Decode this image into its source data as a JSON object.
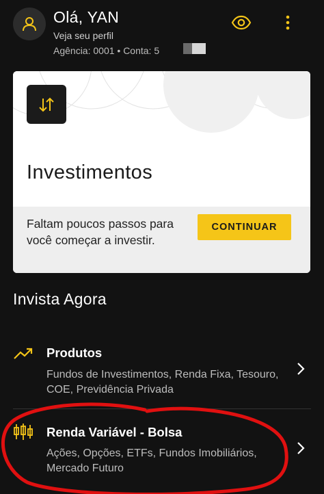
{
  "header": {
    "greeting": "Olá, YAN",
    "profile_link": "Veja seu perfil",
    "account_info": "Agência: 0001 • Conta: 5"
  },
  "card": {
    "title": "Investimentos",
    "description": "Faltam poucos passos para você começar a investir.",
    "button_label": "CONTINUAR",
    "icon": "swap-vertical-icon"
  },
  "section": {
    "title": "Invista Agora"
  },
  "items": [
    {
      "title": "Produtos",
      "subtitle": "Fundos de Investimentos, Renda Fixa, Tesouro, COE, Previdência Privada",
      "icon": "trending-up-icon"
    },
    {
      "title": "Renda Variável - Bolsa",
      "subtitle": "Ações, Opções, ETFs, Fundos Imobiliários, Mercado Futuro",
      "icon": "candlestick-icon"
    }
  ],
  "colors": {
    "accent": "#f5c518",
    "background": "#121212",
    "annotation": "#e01010"
  }
}
